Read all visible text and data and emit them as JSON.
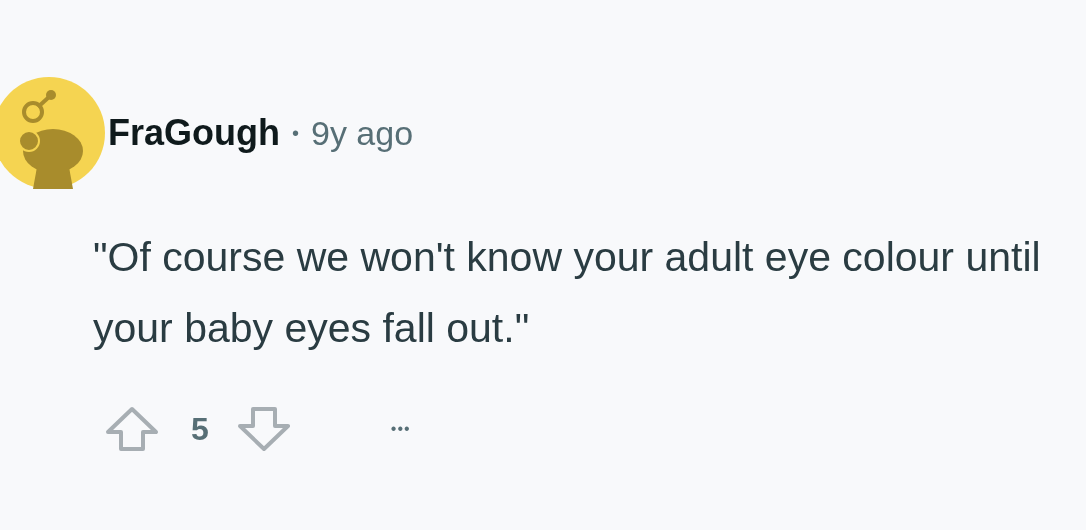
{
  "comment": {
    "author": "FraGough",
    "separator": "•",
    "time": "9y ago",
    "body": "\"Of course we won't know your adult eye colour until your baby eyes fall out.\"",
    "score": "5",
    "more": "•••"
  }
}
